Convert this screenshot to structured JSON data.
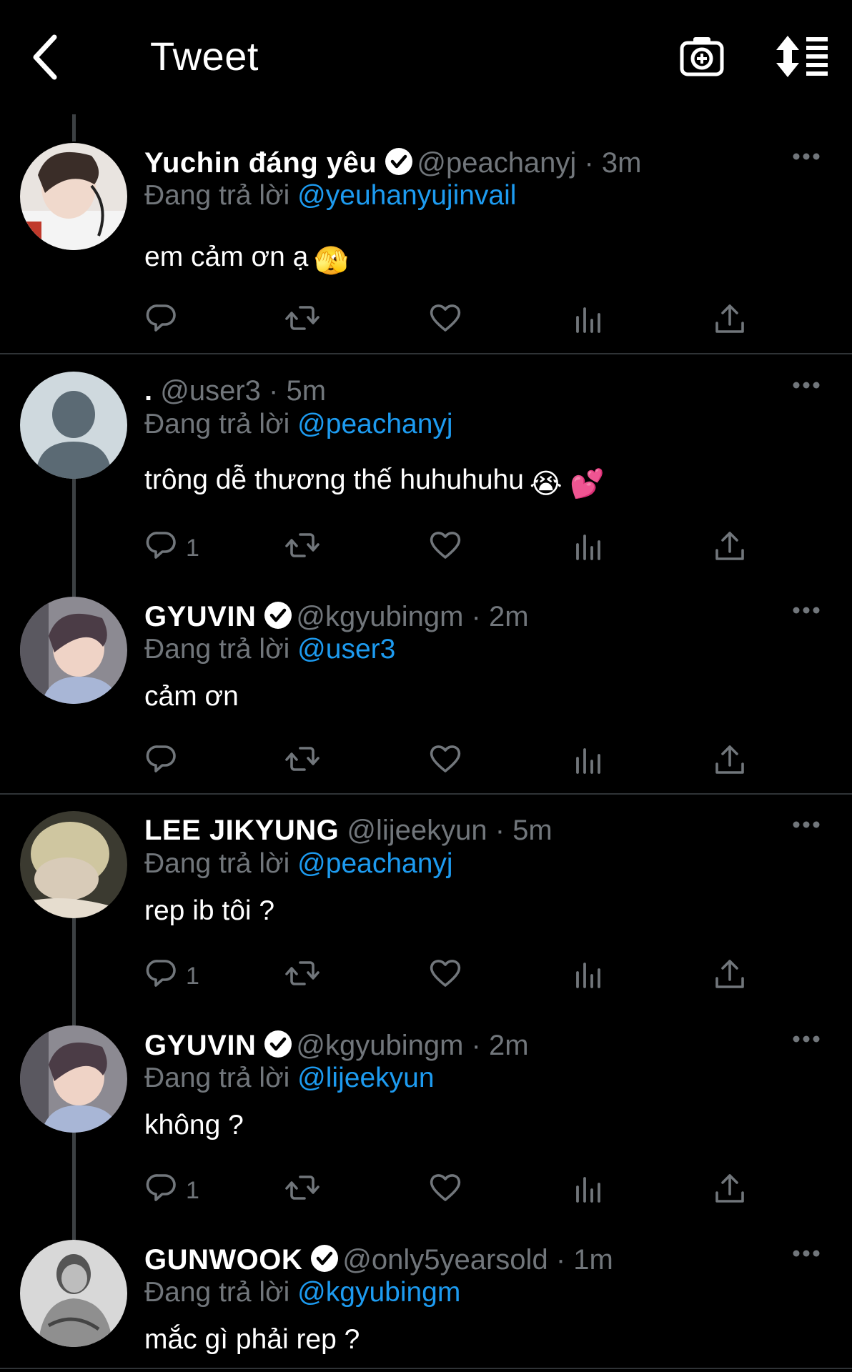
{
  "header": {
    "title": "Tweet",
    "back_icon": "chevron-left-icon",
    "camera_icon": "camera-plus-icon",
    "sort_icon": "sort-lines-icon"
  },
  "colors": {
    "background": "#000000",
    "handle_link": "#1d9bf0",
    "muted": "#71767b"
  },
  "tweets": [
    {
      "name": "Yuchin đáng yêu",
      "verified": true,
      "handle": "@peachanyj",
      "sep": "·",
      "time": "3m",
      "reply_prefix": "Đang trả lời",
      "reply_to": "@yeuhanyujinvail",
      "text": "em cảm ơn ạ",
      "emoji": "🫣",
      "reply_count": ""
    },
    {
      "name": ".",
      "verified": false,
      "handle": "@user3",
      "sep": "·",
      "time": "5m",
      "reply_prefix": "Đang trả lời",
      "reply_to": "@peachanyj",
      "text": "trông dễ thương thế huhuhuhu",
      "emoji": "😭 💕",
      "reply_count": "1"
    },
    {
      "name": "GYUVIN",
      "verified": true,
      "handle": "@kgyubingm",
      "sep": "·",
      "time": "2m",
      "reply_prefix": "Đang trả lời",
      "reply_to": "@user3",
      "text": "cảm ơn",
      "emoji": "",
      "reply_count": ""
    },
    {
      "name": "LEE JIKYUNG",
      "verified": false,
      "handle": "@lijeekyun",
      "sep": "·",
      "time": "5m",
      "reply_prefix": "Đang trả lời",
      "reply_to": "@peachanyj",
      "text": "rep ib tôi ?",
      "emoji": "",
      "reply_count": "1"
    },
    {
      "name": "GYUVIN",
      "verified": true,
      "handle": "@kgyubingm",
      "sep": "·",
      "time": "2m",
      "reply_prefix": "Đang trả lời",
      "reply_to": "@lijeekyun",
      "text": "không ?",
      "emoji": "",
      "reply_count": "1"
    },
    {
      "name": "GUNWOOK",
      "verified": true,
      "handle": "@only5yearsold",
      "sep": "·",
      "time": "1m",
      "reply_prefix": "Đang trả lời",
      "reply_to": "@kgyubingm",
      "text": "mắc gì phải rep ?",
      "emoji": "",
      "reply_count": ""
    }
  ],
  "action_icons": [
    "reply-icon",
    "retweet-icon",
    "like-icon",
    "analytics-icon",
    "share-icon"
  ]
}
